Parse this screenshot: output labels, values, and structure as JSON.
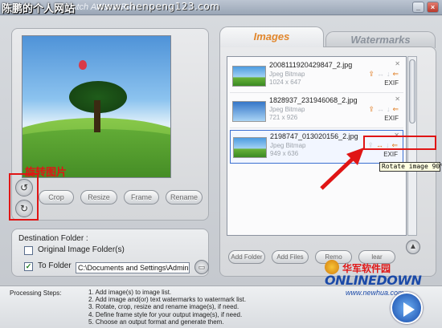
{
  "window": {
    "watermark_cn": "陈鹏的个人网站",
    "watermark_url": "www.chenpeng123.com",
    "ghost_title": "Batch Artisan Pro"
  },
  "preview": {
    "annotation": "旋转图片",
    "rotate_left_icon": "rotate-left-icon",
    "rotate_right_icon": "rotate-right-icon"
  },
  "tools": {
    "crop": "Crop",
    "resize": "Resize",
    "frame": "Frame",
    "rename": "Rename"
  },
  "destination": {
    "label": "Destination Folder :",
    "original_option": "Original Image Folder(s)",
    "original_checked": false,
    "to_folder_option": "To Folder",
    "to_folder_checked": true,
    "path": "C:\\Documents and Settings\\Administra"
  },
  "tabs": {
    "images": "Images",
    "watermarks": "Watermarks",
    "active_color": "#e1862c"
  },
  "images": [
    {
      "name": "2008111920429847_2.jpg",
      "type": "Jpeg Bitmap",
      "dims": "1024 x 647",
      "exif": "EXIF",
      "close": "✕"
    },
    {
      "name": "1828937_231946068_2.jpg",
      "type": "Jpeg Bitmap",
      "dims": "721 x 926",
      "exif": "EXIF",
      "close": "✕"
    },
    {
      "name": "2198747_013020156_2.jpg",
      "type": "Jpeg Bitmap",
      "dims": "949 x 636",
      "exif": "EXIF",
      "close": "✕"
    }
  ],
  "tooltip": "Rotate image 90°",
  "list_buttons": {
    "add_folder": "Add Folder",
    "add_files": "Add Files",
    "remove": "Remo",
    "clear": "lear"
  },
  "logo": {
    "cn": "华军软件园",
    "en": "ONLINEDOWN",
    "url": "www.newhua.com"
  },
  "steps": {
    "title": "Processing Steps:",
    "items": [
      "1. Add image(s) to image list.",
      "2. Add image and(or) text watermarks to watermark list.",
      "3. Rotate, crop, resize and rename image(s), if need.",
      "4. Define frame style for your output image(s), if need.",
      "5. Choose an output format and generate them."
    ]
  },
  "colors": {
    "highlight_red": "#e01515",
    "accent_orange": "#e1862c",
    "selection_blue": "#3b6fd1"
  }
}
